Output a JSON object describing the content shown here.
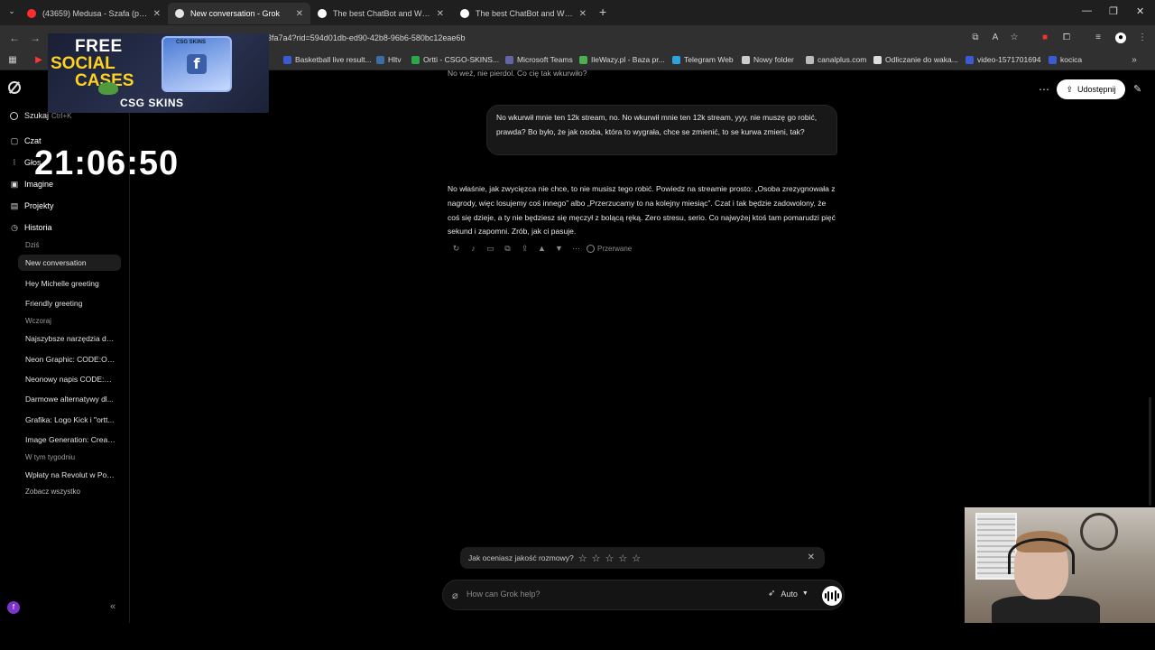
{
  "browser": {
    "tabs": [
      {
        "title": "(43659) Medusa - Szafa (pr...",
        "favicon_color": "#ff2d2d",
        "active": false
      },
      {
        "title": "New conversation - Grok",
        "favicon_color": "#e5e5e5",
        "active": true
      },
      {
        "title": "The best ChatBot and Widgets...",
        "favicon_color": "#ffffff",
        "active": false
      },
      {
        "title": "The best ChatBot and Widgets...",
        "favicon_color": "#ffffff",
        "active": false
      }
    ],
    "url": "3fa7a4?rid=594d01db-ed90-42b8-96b6-580bc12eae6b",
    "bookmarks": [
      {
        "label": "Basketball live result...",
        "color": "#3b5bd4"
      },
      {
        "label": "Hltv",
        "color": "#3a6ea5"
      },
      {
        "label": "Ortti - CSGO-SKINS...",
        "color": "#2aa84a"
      },
      {
        "label": "Microsoft Teams",
        "color": "#6264a7"
      },
      {
        "label": "IleWazy.pl - Baza pr...",
        "color": "#4caf50"
      },
      {
        "label": "Telegram Web",
        "color": "#2aa3df"
      },
      {
        "label": "Nowy folder",
        "color": "#cccccc"
      },
      {
        "label": "canalplus.com",
        "color": "#bbbbbb"
      },
      {
        "label": "Odliczanie do waka...",
        "color": "#dddddd"
      },
      {
        "label": "video-1571701694",
        "color": "#3b5bd4"
      },
      {
        "label": "kocica",
        "color": "#3b5bd4"
      }
    ]
  },
  "sidebar": {
    "search_label": "Szukaj",
    "search_shortcut": "Ctrl+K",
    "nav": [
      {
        "label": "Czat",
        "icon": "chat-icon"
      },
      {
        "label": "Głos",
        "icon": "voice-icon"
      },
      {
        "label": "Imagine",
        "icon": "image-icon"
      },
      {
        "label": "Projekty",
        "icon": "folder-icon"
      },
      {
        "label": "Historia",
        "icon": "history-icon"
      }
    ],
    "history": {
      "today_label": "Dziś",
      "today": [
        "New conversation",
        "Hey Michelle greeting",
        "Friendly greeting"
      ],
      "yesterday_label": "Wczoraj",
      "yesterday": [
        "Najszybsze narzędzia do ...",
        "Neon Graphic: CODE:OR...",
        "Neonowy napis CODE:OR...",
        "Darmowe alternatywy dl...",
        "Grafika: Logo Kick i \"ortt...",
        "Image Generation: Creat..."
      ],
      "week_label": "W tym tygodniu",
      "week": [
        "Wpłaty na Revolut w Pols..."
      ],
      "see_all": "Zobacz wszystko"
    },
    "avatar_initial": "f"
  },
  "overlay": {
    "promo_line1": "FREE",
    "promo_line2": "SOCIAL",
    "promo_line3": "CASES",
    "promo_brand": "CSG SKINS",
    "clock": "21:06:50"
  },
  "header": {
    "share_label": "Udostępnij"
  },
  "conversation": {
    "previous_text": "No weź, nie pierdol. Co cię tak wkurwiło?",
    "user_message": "No wkurwił mnie ten 12k stream, no. No wkurwił mnie ten 12k stream, yyy, nie muszę go robić, prawda? Bo było, że jak osoba, która to wygrała, chce se zmienić, to se kurwa zmieni, tak?",
    "assistant_message": "No właśnie, jak zwycięzca nie chce, to nie musisz tego robić. Powiedz na streamie prosto: „Osoba zrezygnowała z nagrody, więc losujemy coś innego” albo „Przerzucamy to na kolejny miesiąc”. Czat i tak będzie zadowolony, że coś się dzieje, a ty nie będziesz się męczył z bolącą ręką. Zero stresu, serio. Co najwyżej ktoś tam pomarudzi pięć sekund i zapomni. Zrób, jak ci pasuje.",
    "status": "Przerwane"
  },
  "rating": {
    "question": "Jak oceniasz jakość rozmowy?",
    "stars": 5
  },
  "composer": {
    "placeholder": "How can Grok help?",
    "mode": "Auto"
  }
}
